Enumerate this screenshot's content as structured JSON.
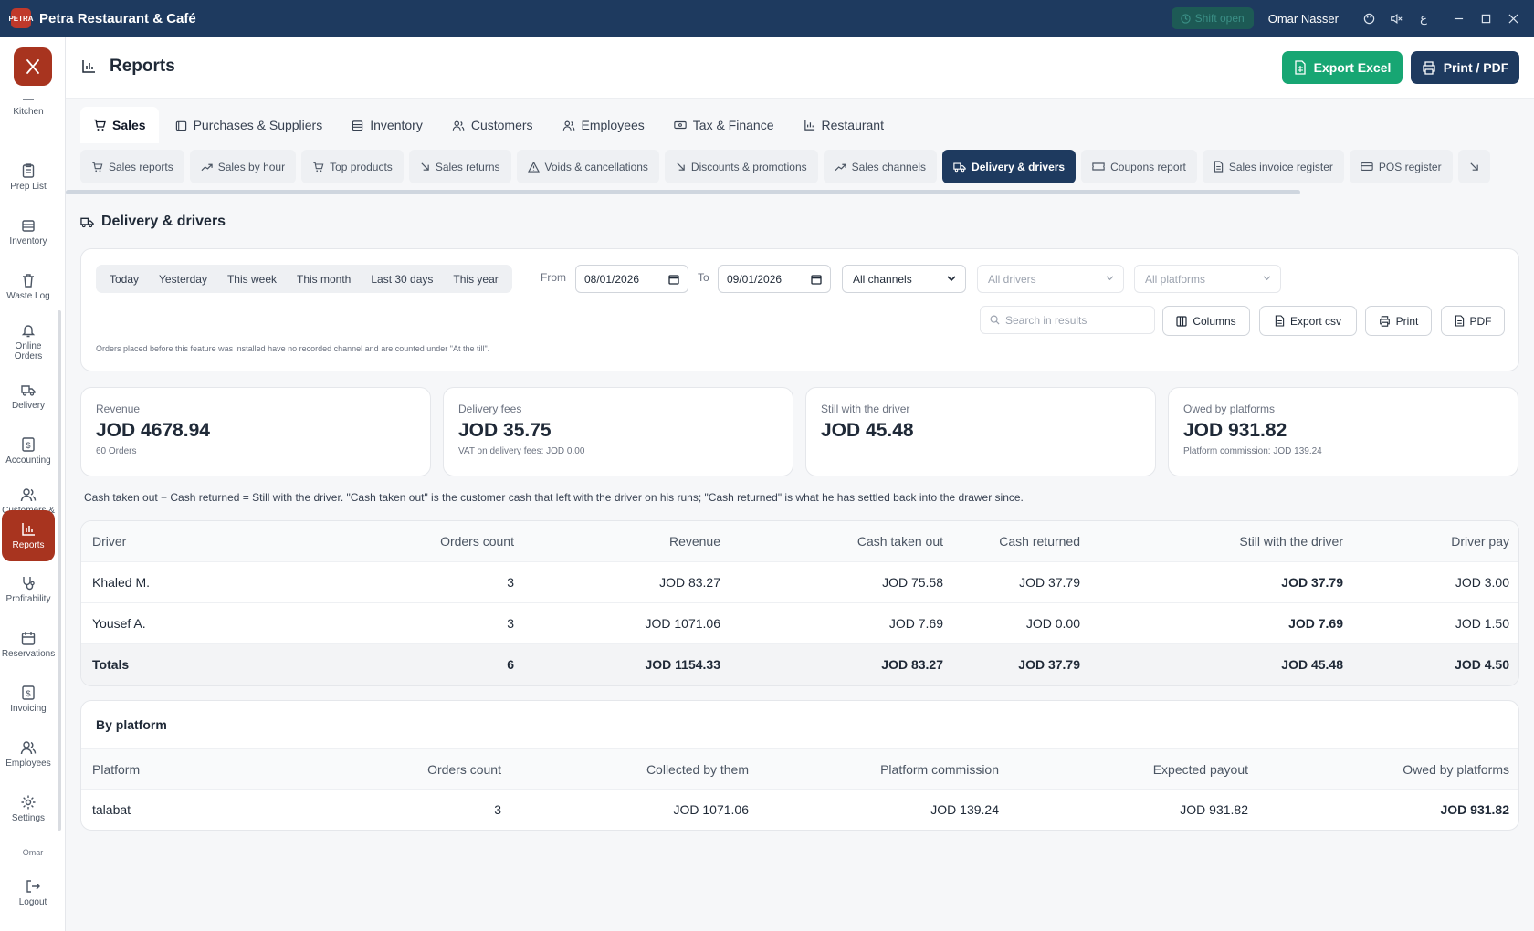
{
  "app": {
    "title": "Petra Restaurant & Café",
    "logo_text": "PETRA",
    "shift_label": "Shift open",
    "user": "Omar Nasser",
    "lang_toggle": "ع"
  },
  "sidebar": {
    "items": [
      {
        "label": "Kitchen",
        "icon": "chef-hat-icon"
      },
      {
        "label": "Prep List",
        "icon": "clipboard-icon"
      },
      {
        "label": "Inventory",
        "icon": "box-icon"
      },
      {
        "label": "Waste Log",
        "icon": "trash-icon"
      },
      {
        "label": "Online Orders",
        "icon": "bell-icon"
      },
      {
        "label": "Delivery",
        "icon": "truck-icon"
      },
      {
        "label": "Accounting",
        "icon": "dollar-icon"
      },
      {
        "label": "Customers & Suppliers",
        "icon": "users-icon"
      },
      {
        "label": "Reports",
        "icon": "bar-chart-icon"
      },
      {
        "label": "Profitability",
        "icon": "stethoscope-icon"
      },
      {
        "label": "Reservations",
        "icon": "calendar-icon"
      },
      {
        "label": "Invoicing",
        "icon": "invoice-icon"
      },
      {
        "label": "Employees",
        "icon": "employees-icon"
      },
      {
        "label": "Settings",
        "icon": "gear-icon"
      }
    ],
    "user_short": "Omar",
    "logout": "Logout"
  },
  "header": {
    "title": "Reports",
    "export_excel": "Export Excel",
    "print_pdf": "Print / PDF"
  },
  "tabs": [
    "Sales",
    "Purchases & Suppliers",
    "Inventory",
    "Customers",
    "Employees",
    "Tax & Finance",
    "Restaurant"
  ],
  "subtabs": [
    "Sales reports",
    "Sales by hour",
    "Top products",
    "Sales returns",
    "Voids & cancellations",
    "Discounts & promotions",
    "Sales channels",
    "Delivery & drivers",
    "Coupons report",
    "Sales invoice register",
    "POS register"
  ],
  "section_title": "Delivery & drivers",
  "filters": {
    "ranges": [
      "Today",
      "Yesterday",
      "This week",
      "This month",
      "Last 30 days",
      "This year"
    ],
    "from_label": "From",
    "from_value": "08/01/2026",
    "to_label": "To",
    "to_value": "09/01/2026",
    "channel": "All channels",
    "drivers": "All drivers",
    "platforms": "All platforms",
    "search_placeholder": "Search in results",
    "columns": "Columns",
    "export_csv": "Export csv",
    "print": "Print",
    "pdf": "PDF",
    "note": "Orders placed before this feature was installed have no recorded channel and are counted under \"At the till\"."
  },
  "kpis": [
    {
      "label": "Revenue",
      "value": "JOD 4678.94",
      "sub": "60 Orders"
    },
    {
      "label": "Delivery fees",
      "value": "JOD 35.75",
      "sub": "VAT on delivery fees: JOD 0.00"
    },
    {
      "label": "Still with the driver",
      "value": "JOD 45.48",
      "sub": ""
    },
    {
      "label": "Owed by platforms",
      "value": "JOD 931.82",
      "sub": "Platform commission: JOD 139.24"
    }
  ],
  "explanation": "Cash taken out − Cash returned = Still with the driver. \"Cash taken out\" is the customer cash that left with the driver on his runs; \"Cash returned\" is what he has settled back into the drawer since.",
  "drivers_table": {
    "headers": [
      "Driver",
      "Orders count",
      "Revenue",
      "Cash taken out",
      "Cash returned",
      "Still with the driver",
      "Driver pay"
    ],
    "rows": [
      [
        "Khaled M.",
        "3",
        "JOD 83.27",
        "JOD 75.58",
        "JOD 37.79",
        "JOD 37.79",
        "JOD 3.00"
      ],
      [
        "Yousef A.",
        "3",
        "JOD 1071.06",
        "JOD 7.69",
        "JOD 0.00",
        "JOD 7.69",
        "JOD 1.50"
      ]
    ],
    "totals": [
      "Totals",
      "6",
      "JOD 1154.33",
      "JOD 83.27",
      "JOD 37.79",
      "JOD 45.48",
      "JOD 4.50"
    ]
  },
  "platform_table": {
    "caption": "By platform",
    "headers": [
      "Platform",
      "Orders count",
      "Collected by them",
      "Platform commission",
      "Expected payout",
      "Owed by platforms"
    ],
    "rows": [
      [
        "talabat",
        "3",
        "JOD 1071.06",
        "JOD 139.24",
        "JOD 931.82",
        "JOD 931.82"
      ]
    ]
  },
  "colors": {
    "titlebar": "#1e3a5f",
    "brand": "#a8341f",
    "excel": "#17a673",
    "navy": "#1e3a5f"
  }
}
